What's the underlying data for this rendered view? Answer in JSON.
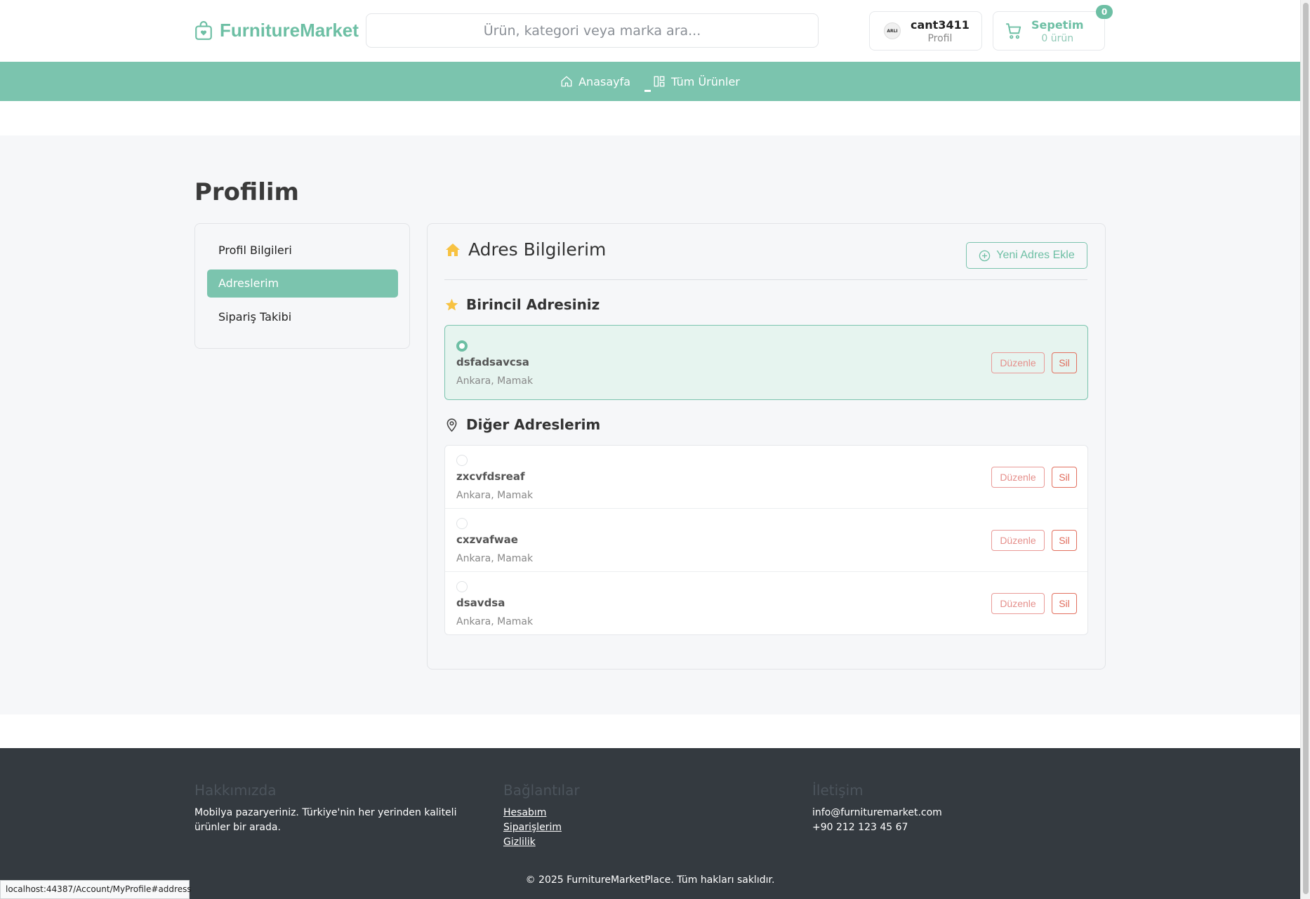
{
  "header": {
    "logo_text": "FurnitureMarket",
    "search_placeholder": "Ürün, kategori veya marka ara...",
    "user": {
      "name": "cant3411",
      "sub": "Profil",
      "avatar_text": "ARLI"
    },
    "cart": {
      "title": "Sepetim",
      "sub": "0 ürün",
      "badge": "0"
    }
  },
  "nav": {
    "items": [
      {
        "label": "Anasayfa",
        "icon": "home-icon"
      },
      {
        "label": "Tüm Ürünler",
        "icon": "grid-icon"
      }
    ]
  },
  "page": {
    "title": "Profilim"
  },
  "sidebar": {
    "items": [
      {
        "label": "Profil Bilgileri",
        "active": false
      },
      {
        "label": "Adreslerim",
        "active": true
      },
      {
        "label": "Sipariş Takibi",
        "active": false
      }
    ]
  },
  "addresses": {
    "title": "Adres Bilgilerim",
    "add_button": "Yeni Adres Ekle",
    "primary_heading": "Birincil Adresiniz",
    "other_heading": "Diğer Adreslerim",
    "edit_label": "Düzenle",
    "delete_label": "Sil",
    "primary": {
      "name": "dsfadsavcsa",
      "location": "Ankara, Mamak"
    },
    "others": [
      {
        "name": "zxcvfdsreaf",
        "location": "Ankara, Mamak"
      },
      {
        "name": "cxzvafwae",
        "location": "Ankara, Mamak"
      },
      {
        "name": "dsavdsa",
        "location": "Ankara, Mamak"
      }
    ]
  },
  "footer": {
    "about_title": "Hakkımızda",
    "about_text": "Mobilya pazaryeriniz. Türkiye'nin her yerinden kaliteli ürünler bir arada.",
    "links_title": "Bağlantılar",
    "links": [
      "Hesabım",
      "Siparişlerim",
      "Gizlilik"
    ],
    "contact_title": "İletişim",
    "email": "info@furnituremarket.com",
    "phone": "+90 212 123 45 67",
    "copyright": "© 2025 FurnitureMarketPlace. Tüm hakları saklıdır."
  },
  "statusbar": "localhost:44387/Account/MyProfile#address",
  "colors": {
    "accent": "#7bc4ae",
    "footer_bg": "#343a40",
    "danger": "#e06a5a"
  }
}
